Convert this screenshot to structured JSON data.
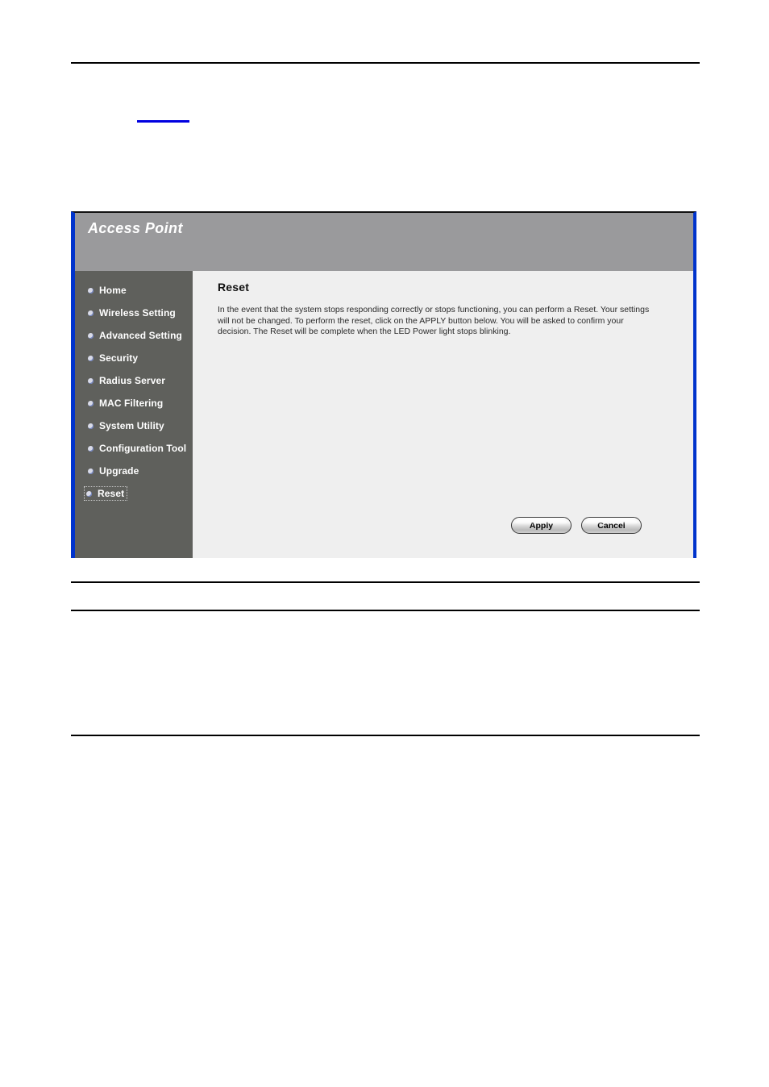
{
  "page": {
    "top_link_text": "",
    "rules_count": 4
  },
  "panel": {
    "header_title": "Access Point",
    "accent_color": "#0033cc",
    "header_bg": "#9a9a9c",
    "sidebar_bg": "#5f605c",
    "content_bg": "#efefef"
  },
  "sidebar": {
    "items": [
      {
        "label": "Home",
        "focused": false
      },
      {
        "label": "Wireless Setting",
        "focused": false
      },
      {
        "label": "Advanced Setting",
        "focused": false
      },
      {
        "label": "Security",
        "focused": false
      },
      {
        "label": "Radius Server",
        "focused": false
      },
      {
        "label": "MAC Filtering",
        "focused": false
      },
      {
        "label": "System Utility",
        "focused": false
      },
      {
        "label": "Configuration Tool",
        "focused": false
      },
      {
        "label": "Upgrade",
        "focused": false
      },
      {
        "label": "Reset",
        "focused": true
      }
    ]
  },
  "content": {
    "title": "Reset",
    "paragraph": "In the event that the system stops responding correctly or stops functioning, you can perform a Reset. Your settings will not be changed. To perform the reset, click on the APPLY button below. You will be asked to confirm your decision. The Reset will be complete when the LED Power light stops blinking."
  },
  "buttons": {
    "apply_label": "Apply",
    "cancel_label": "Cancel"
  }
}
